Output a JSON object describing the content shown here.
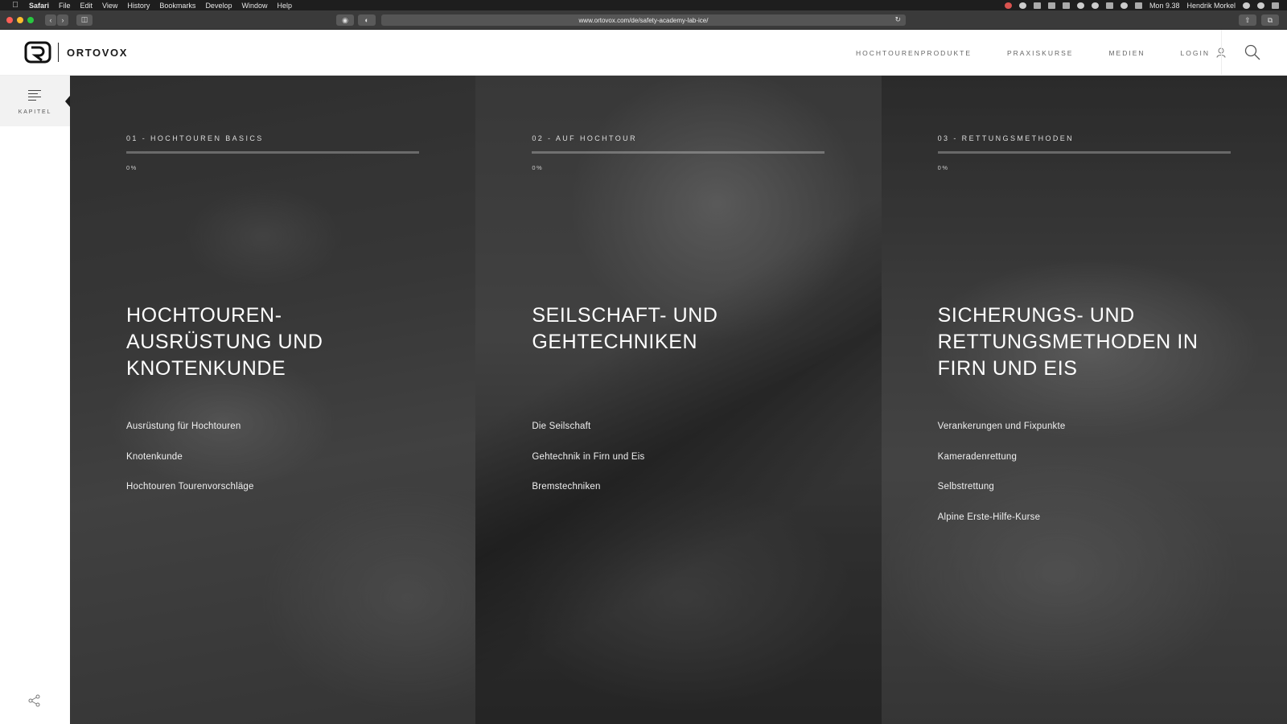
{
  "os_menubar": {
    "app": "Safari",
    "menus": [
      "File",
      "Edit",
      "View",
      "History",
      "Bookmarks",
      "Develop",
      "Window",
      "Help"
    ],
    "clock": "Mon 9.38",
    "user": "Hendrik Morkel"
  },
  "browser": {
    "url": "www.ortovox.com/de/safety-academy-lab-ice/"
  },
  "header": {
    "logo_text": "ORTOVOX",
    "nav": [
      "HOCHTOURENPRODUKTE",
      "PRAXISKURSE",
      "MEDIEN"
    ],
    "login_label": "LOGIN"
  },
  "rail": {
    "kapitel_label": "KAPITEL"
  },
  "panels": [
    {
      "kicker": "01 - HOCHTOUREN BASICS",
      "progress": 0,
      "progress_label": "0%",
      "heading": "HOCHTOUREN-AUSRÜSTUNG UND KNOTENKUNDE",
      "chapters": [
        "Ausrüstung für Hochtouren",
        "Knotenkunde",
        "Hochtouren Tourenvorschläge"
      ]
    },
    {
      "kicker": "02 - AUF HOCHTOUR",
      "progress": 0,
      "progress_label": "0%",
      "heading": "SEILSCHAFT- UND GEHTECHNIKEN",
      "chapters": [
        "Die Seilschaft",
        "Gehtechnik in Firn und Eis",
        "Bremstechniken"
      ]
    },
    {
      "kicker": "03 - RETTUNGSMETHODEN",
      "progress": 0,
      "progress_label": "0%",
      "heading": "SICHERUNGS- UND RETTUNGSMETHODEN IN FIRN UND EIS",
      "chapters": [
        "Verankerungen und Fixpunkte",
        "Kameradenrettung",
        "Selbstrettung",
        "Alpine Erste-Hilfe-Kurse"
      ]
    }
  ],
  "icons": {
    "menu": "hamburger-icon",
    "user": "user-icon",
    "search": "search-icon",
    "share": "share-icon"
  }
}
